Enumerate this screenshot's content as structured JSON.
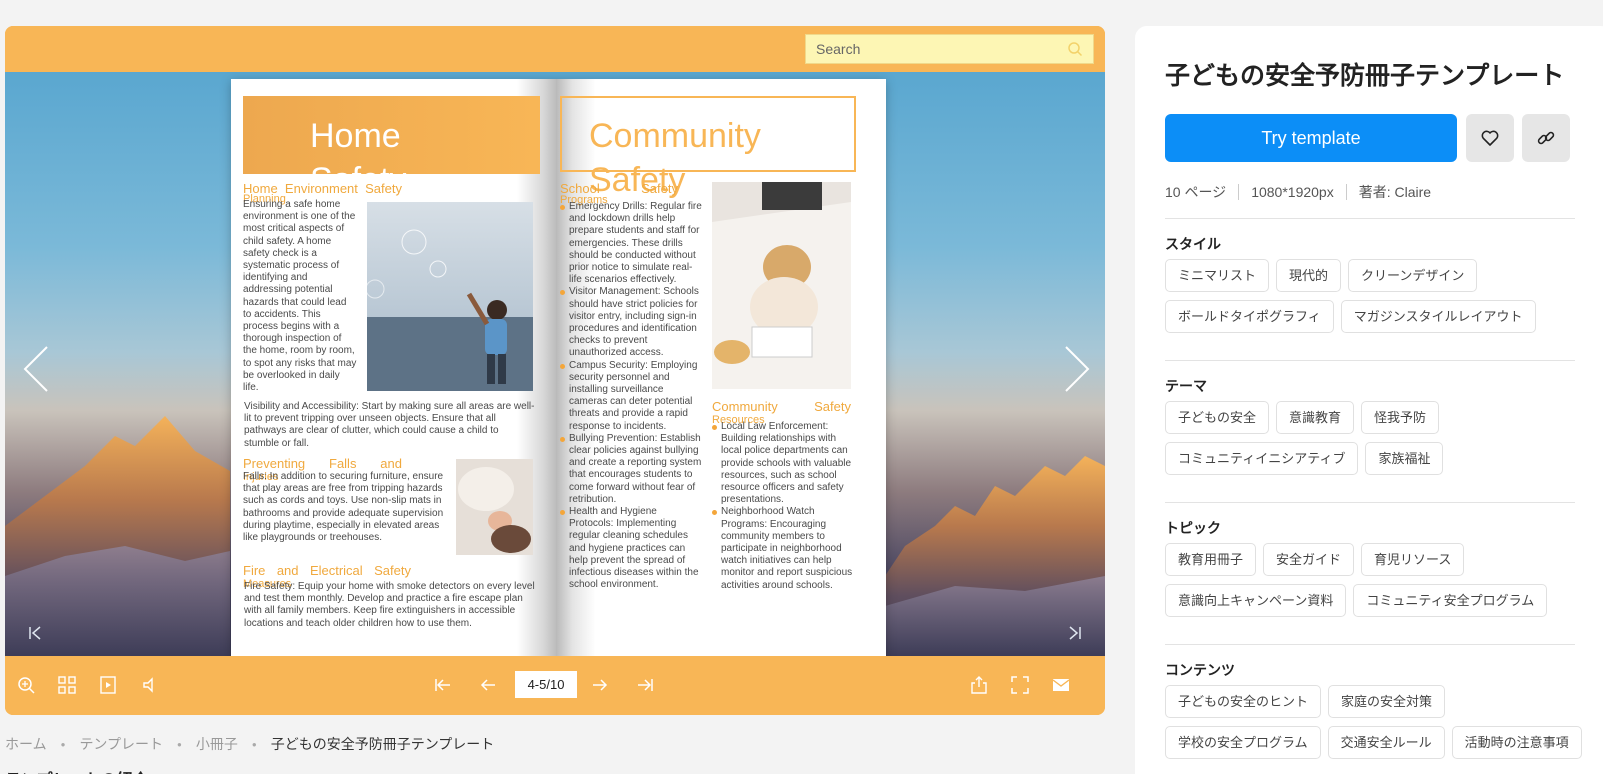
{
  "viewer": {
    "search_placeholder": "Search",
    "page_indicator": "4-5/10",
    "left_page": {
      "title_line1": "Home",
      "title_line2": "Safety",
      "sec1_head_words": [
        "Home",
        "Environment",
        "Safety"
      ],
      "sec1_sub": "Planning",
      "sec1_text": "Ensuring a safe home environment is one of the most critical aspects of child safety. A home safety check is a systematic process of identifying and addressing potential hazards that could lead to accidents. This process begins with a thorough inspection of the home, room by room, to spot any risks that may be overlooked in daily life.",
      "sec1_text2": "Visibility and Accessibility: Start by making sure all areas are well-lit to prevent tripping over unseen objects. Ensure that all pathways are clear of clutter, which could cause a child to stumble or fall.",
      "sec2_head_words": [
        "Preventing",
        "Falls",
        "and"
      ],
      "sec2_sub": "Injuries",
      "sec2_text": "Falls: In addition to securing furniture, ensure that play areas are free from tripping hazards such as cords and toys. Use non-slip mats in bathrooms and provide adequate supervision during playtime, especially in elevated areas like playgrounds or treehouses.",
      "sec3_head_words": [
        "Fire",
        "and",
        "Electrical",
        "Safety"
      ],
      "sec3_sub": "Measures",
      "sec3_text": "Fire Safety: Equip your home with smoke detectors on every level and test them monthly. Develop and practice a fire escape plan with all family members. Keep fire extinguishers in accessible locations and teach older children how to use them."
    },
    "right_page": {
      "title_line1": "Community",
      "title_line2": "Safety",
      "sec1_head_words": [
        "School",
        "Safety"
      ],
      "sec1_sub": "Programs",
      "sec1_items": [
        "Emergency Drills: Regular fire and lockdown drills help prepare students and staff for emergencies. These drills should be conducted without prior notice to simulate real-life scenarios effectively.",
        "Visitor Management: Schools should have strict policies for visitor entry, including sign-in procedures and identification checks to prevent unauthorized access.",
        "Campus Security: Employing security personnel and installing surveillance cameras can deter potential threats and provide a rapid response to incidents.",
        "Bullying Prevention: Establish clear policies against bullying and create a reporting system that encourages students to come forward without fear of retribution.",
        "Health and Hygiene Protocols: Implementing regular cleaning schedules and hygiene practices can help prevent the spread of infectious diseases within the school environment."
      ],
      "sec2_head_words": [
        "Community",
        "Safety"
      ],
      "sec2_sub": "Resources",
      "sec2_items": [
        "Local Law Enforcement: Building relationships with local police departments can provide schools with valuable resources, such as school resource officers and safety presentations.",
        "Neighborhood Watch Programs: Encouraging community members to participate in neighborhood watch initiatives can help monitor and report suspicious activities around schools."
      ]
    }
  },
  "breadcrumb": {
    "home": "ホーム",
    "templates": "テンプレート",
    "booklets": "小冊子",
    "current": "子どもの安全予防冊子テンプレート"
  },
  "below_heading": "テンプレートの紹介",
  "panel": {
    "title": "子どもの安全予防冊子テンプレート",
    "try_label": "Try template",
    "pages": "10 ページ",
    "size": "1080*1920px",
    "author": "著者: Claire",
    "style_label": "スタイル",
    "style_tags": [
      "ミニマリスト",
      "現代的",
      "クリーンデザイン",
      "ボールドタイポグラフィ",
      "マガジンスタイルレイアウト"
    ],
    "theme_label": "テーマ",
    "theme_tags": [
      "子どもの安全",
      "意識教育",
      "怪我予防",
      "コミュニティイニシアティブ",
      "家族福祉"
    ],
    "topic_label": "トピック",
    "topic_tags": [
      "教育用冊子",
      "安全ガイド",
      "育児リソース",
      "意識向上キャンペーン資料",
      "コミュニティ安全プログラム"
    ],
    "content_label": "コンテンツ",
    "content_tags": [
      "子どもの安全のヒント",
      "家庭の安全対策",
      "学校の安全プログラム",
      "交通安全ルール",
      "活動時の注意事項"
    ]
  },
  "colors": {
    "accent": "#f8b656",
    "primary_button": "#0c8ef7",
    "search_bg": "#fdf6b4"
  },
  "icons": [
    "search-icon",
    "chevron-left-icon",
    "chevron-right-icon",
    "first-page-icon",
    "last-page-icon",
    "zoom-icon",
    "grid-icon",
    "autoplay-icon",
    "sound-icon",
    "first-icon",
    "prev-icon",
    "next-icon",
    "last-icon",
    "share-icon",
    "fullscreen-icon",
    "mail-icon",
    "heart-icon",
    "link-icon"
  ]
}
